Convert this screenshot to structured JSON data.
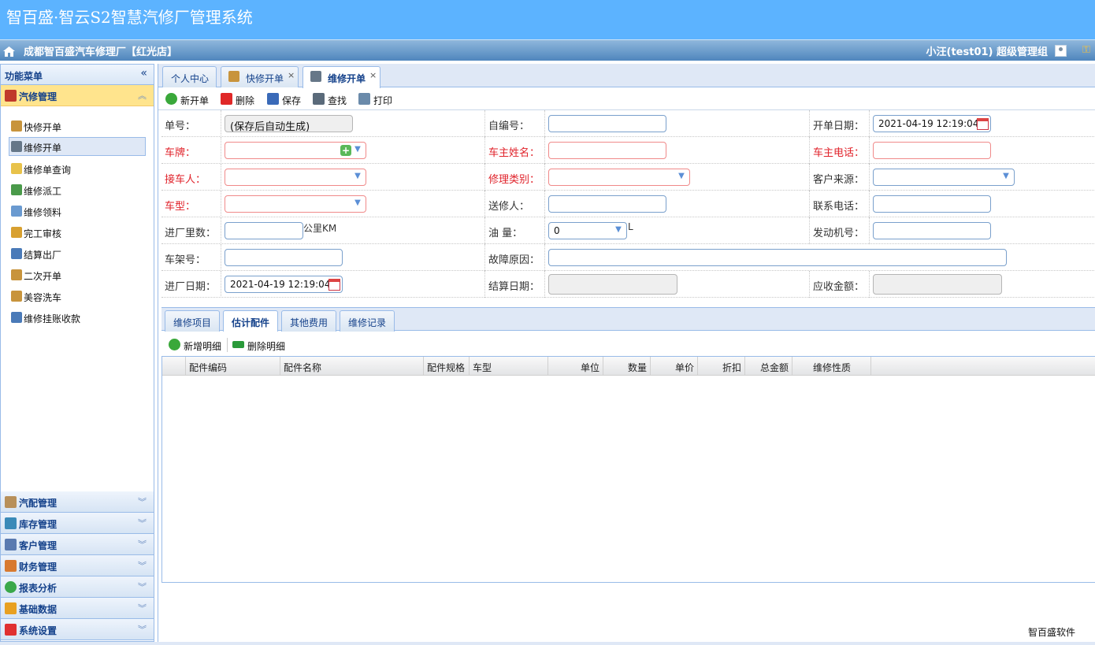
{
  "header": {
    "app_title": "智百盛·智云S2智慧汽修厂管理系统",
    "shop_name": "成都智百盛汽车修理厂【红光店】",
    "user_info": "小汪(test01)  超级管理组"
  },
  "sidebar": {
    "title": "功能菜单",
    "collapse_glyph": "«",
    "active_section": {
      "label": "汽修管理",
      "icon": "tools-icon",
      "color": "#c0392b"
    },
    "items": [
      {
        "label": "快修开单",
        "icon": "box-icon",
        "color": "#c8943c"
      },
      {
        "label": "维修开单",
        "icon": "wrench-screwdriver-icon",
        "color": "#667788"
      },
      {
        "label": "维修单查询",
        "icon": "folder-search-icon",
        "color": "#e8c24a"
      },
      {
        "label": "维修派工",
        "icon": "checklist-icon",
        "color": "#4a9a4a"
      },
      {
        "label": "维修领料",
        "icon": "edit-icon",
        "color": "#6a9ad0"
      },
      {
        "label": "完工审核",
        "icon": "stamp-icon",
        "color": "#d8a030"
      },
      {
        "label": "结算出厂",
        "icon": "car-icon",
        "color": "#4a7ab8"
      },
      {
        "label": "二次开单",
        "icon": "box-icon",
        "color": "#c8943c"
      },
      {
        "label": "美容洗车",
        "icon": "box-icon",
        "color": "#c8943c"
      },
      {
        "label": "维修挂账收款",
        "icon": "person-icon",
        "color": "#4a7ab8"
      }
    ],
    "sections": [
      {
        "label": "汽配管理",
        "icon": "parts-icon",
        "color": "#b8905a"
      },
      {
        "label": "库存管理",
        "icon": "warehouse-icon",
        "color": "#3a8ab8"
      },
      {
        "label": "客户管理",
        "icon": "customer-icon",
        "color": "#5a7ab0"
      },
      {
        "label": "财务管理",
        "icon": "finance-icon",
        "color": "#d87a30"
      },
      {
        "label": "报表分析",
        "icon": "pie-chart-icon",
        "color": "#3aa84a"
      },
      {
        "label": "基础数据",
        "icon": "database-icon",
        "color": "#e8a020"
      },
      {
        "label": "系统设置",
        "icon": "gear-icon",
        "color": "#e03030"
      }
    ]
  },
  "tabs": [
    {
      "label": "个人中心",
      "closable": false
    },
    {
      "label": "快修开单",
      "closable": true
    },
    {
      "label": "维修开单",
      "closable": true
    }
  ],
  "toolbar": {
    "new": "新开单",
    "delete": "删除",
    "save": "保存",
    "find": "查找",
    "print": "打印"
  },
  "form": {
    "order_no": {
      "label": "单号：",
      "value": "(保存后自动生成)"
    },
    "self_no": {
      "label": "自编号：",
      "value": ""
    },
    "open_date": {
      "label": "开单日期：",
      "value": "2021-04-19 12:19:04"
    },
    "plate": {
      "label": "车牌：",
      "value": ""
    },
    "owner_name": {
      "label": "车主姓名：",
      "value": ""
    },
    "owner_phone": {
      "label": "车主电话：",
      "value": ""
    },
    "receiver": {
      "label": "接车人：",
      "value": ""
    },
    "repair_type": {
      "label": "修理类别：",
      "value": ""
    },
    "customer_source": {
      "label": "客户来源：",
      "value": ""
    },
    "car_model": {
      "label": "车型：",
      "value": ""
    },
    "sender": {
      "label": "送修人：",
      "value": ""
    },
    "contact_phone": {
      "label": "联系电话：",
      "value": ""
    },
    "mileage": {
      "label": "进厂里数：",
      "value": "",
      "unit": "公里KM"
    },
    "fuel": {
      "label": "油 量：",
      "value": "0",
      "unit": "L"
    },
    "engine_no": {
      "label": "发动机号：",
      "value": ""
    },
    "vin": {
      "label": "车架号：",
      "value": ""
    },
    "fault": {
      "label": "故障原因：",
      "value": ""
    },
    "enter_date": {
      "label": "进厂日期：",
      "value": "2021-04-19 12:19:04"
    },
    "settle_date": {
      "label": "结算日期：",
      "value": ""
    },
    "receivable": {
      "label": "应收金额：",
      "value": ""
    }
  },
  "subtabs": [
    {
      "label": "维修项目",
      "active": false
    },
    {
      "label": "估计配件",
      "active": true
    },
    {
      "label": "其他费用",
      "active": false
    },
    {
      "label": "维修记录",
      "active": false
    }
  ],
  "subtoolbar": {
    "add": "新增明细",
    "remove": "删除明细"
  },
  "grid": {
    "columns": [
      "配件编码",
      "配件名称",
      "配件规格",
      "车型",
      "单位",
      "数量",
      "单价",
      "折扣",
      "总金额",
      "维修性质"
    ],
    "rows": []
  },
  "footer": "智百盛软件"
}
